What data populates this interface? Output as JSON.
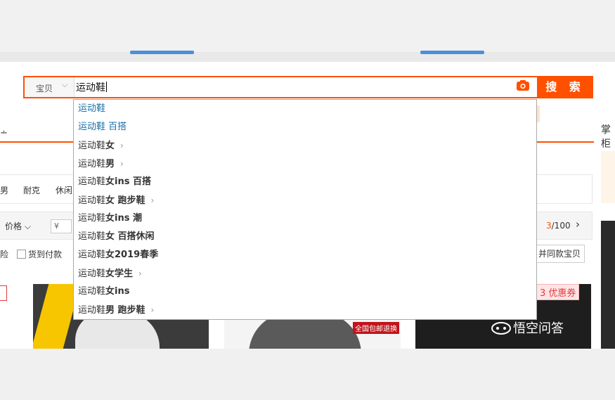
{
  "search": {
    "category": "宝贝",
    "query": "运动鞋",
    "button_label": "搜 索"
  },
  "suggestions": [
    {
      "base": "运动鞋",
      "extra": "",
      "style": "link",
      "arrow": false
    },
    {
      "base": "运动鞋",
      "extra": " 百搭",
      "style": "link",
      "arrow": false
    },
    {
      "base": "运动鞋",
      "extra": "女",
      "style": "bold",
      "arrow": true
    },
    {
      "base": "运动鞋",
      "extra": "男",
      "style": "bold",
      "arrow": true
    },
    {
      "base": "运动鞋",
      "extra": "女ins 百搭",
      "style": "bold",
      "arrow": false
    },
    {
      "base": "运动鞋",
      "extra": "女 跑步鞋",
      "style": "bold",
      "arrow": true
    },
    {
      "base": "运动鞋",
      "extra": "女ins 潮",
      "style": "bold",
      "arrow": false
    },
    {
      "base": "运动鞋",
      "extra": "女 百搭休闲",
      "style": "bold",
      "arrow": false
    },
    {
      "base": "运动鞋",
      "extra": "女2019春季",
      "style": "bold",
      "arrow": false
    },
    {
      "base": "运动鞋",
      "extra": "女学生",
      "style": "bold",
      "arrow": true
    },
    {
      "base": "运动鞋",
      "extra": "女ins",
      "style": "bold",
      "arrow": false
    },
    {
      "base": "运动鞋",
      "extra": "男 跑步鞋",
      "style": "bold",
      "arrow": true
    }
  ],
  "right_panel": {
    "label": "掌柜"
  },
  "brands": [
    "男",
    "耐克",
    "休闲"
  ],
  "filters": {
    "price_label": "价格",
    "price_placeholder": "¥",
    "page_current": "3",
    "page_total": "/100"
  },
  "services": {
    "insurance": "险",
    "cod": "货到付款",
    "merge_button": "并同款宝贝"
  },
  "products": {
    "badge": "全国包邮退换",
    "coupon": "3 优惠券",
    "watermark": "悟空问答"
  },
  "colors": {
    "accent": "#ff5000",
    "link": "#1a6fa8",
    "tab_blue": "#4a90d9"
  }
}
